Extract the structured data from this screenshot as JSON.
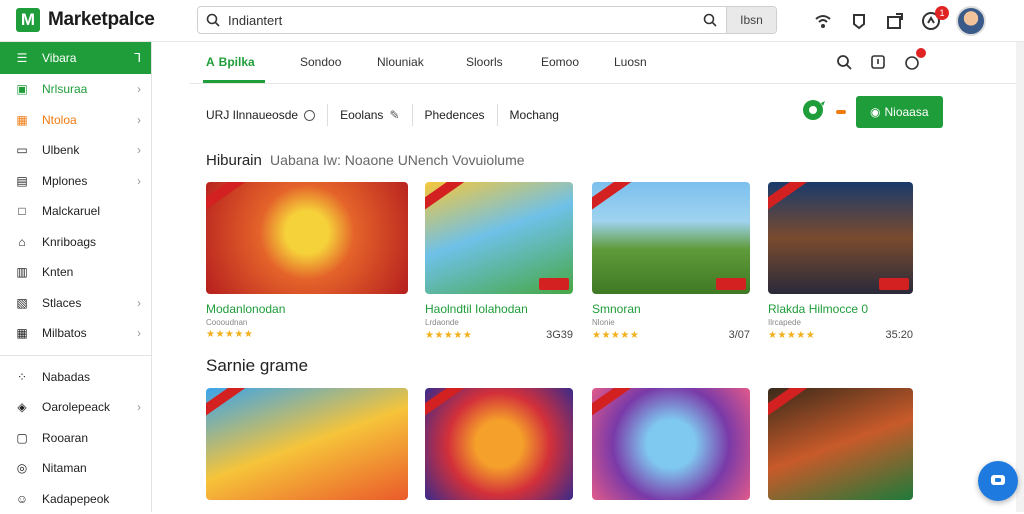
{
  "app": {
    "title": "Marketpalce"
  },
  "search": {
    "value": "Indiantert",
    "filter_label": "Ibsn"
  },
  "header": {
    "notification_count": "1"
  },
  "sidebar": {
    "items": [
      {
        "label": "Vibara",
        "icon": "list-icon",
        "chevron": "⅂",
        "state": "active"
      },
      {
        "label": "Nrlsuraa",
        "icon": "image-icon",
        "chevron": "›",
        "state": "green"
      },
      {
        "label": "Ntoloa",
        "icon": "grid-icon",
        "chevron": "›",
        "state": "orange"
      },
      {
        "label": "Ulbenk",
        "icon": "card-icon",
        "chevron": "›",
        "state": ""
      },
      {
        "label": "Mplones",
        "icon": "apps-icon",
        "chevron": "›",
        "state": ""
      },
      {
        "label": "Malckaruel",
        "icon": "square-icon",
        "chevron": "",
        "state": ""
      },
      {
        "label": "Knriboags",
        "icon": "home-icon",
        "chevron": "",
        "state": ""
      },
      {
        "label": "Knten",
        "icon": "calendar-icon",
        "chevron": "",
        "state": ""
      },
      {
        "label": "Stlaces",
        "icon": "bookmark-icon",
        "chevron": "›",
        "state": ""
      },
      {
        "label": "Milbatos",
        "icon": "table-icon",
        "chevron": "›",
        "state": ""
      }
    ],
    "items2": [
      {
        "label": "Nabadas",
        "icon": "grid-dots-icon",
        "chevron": ""
      },
      {
        "label": "Oarolepeack",
        "icon": "tag-icon",
        "chevron": "›"
      },
      {
        "label": "Rooaran",
        "icon": "box-icon",
        "chevron": ""
      },
      {
        "label": "Nitaman",
        "icon": "target-icon",
        "chevron": ""
      },
      {
        "label": "Kadapepeok",
        "icon": "person-icon",
        "chevron": ""
      }
    ]
  },
  "tabs": [
    "Bpilka",
    "Sondoo",
    "Nlouniak",
    "Sloorls",
    "Eomoo",
    "Luosn"
  ],
  "filters": [
    "URJ Ilnnaueosde",
    "Eoolans",
    "Phedences",
    "Mochang"
  ],
  "cta": {
    "label": "Nioaasa"
  },
  "sections": [
    {
      "title": "Hiburain",
      "subtitle": "Uabana  Iw: Noaone UNench Vovuiolume",
      "cards": [
        {
          "title": "Modanlonodan",
          "sub": "Coooudnan",
          "rating": "★★★★★",
          "price": ""
        },
        {
          "title": "Haolndtil Iolahodan",
          "sub": "Lrdaonde",
          "rating": "★★★★★",
          "price": "3G39"
        },
        {
          "title": "Smnoran",
          "sub": "Nlonie",
          "rating": "★★★★★",
          "price": "3/07"
        },
        {
          "title": "Rlakda Hilmocce 0",
          "sub": "Ilrcapede",
          "rating": "★★★★★",
          "price": "35:20"
        }
      ]
    },
    {
      "title": "Sarnie grame",
      "subtitle": "",
      "cards": [
        {
          "title": "",
          "sub": "",
          "rating": "",
          "price": ""
        },
        {
          "title": "",
          "sub": "",
          "rating": "",
          "price": ""
        },
        {
          "title": "",
          "sub": "",
          "rating": "",
          "price": ""
        },
        {
          "title": "",
          "sub": "",
          "rating": "",
          "price": ""
        }
      ]
    }
  ],
  "colors": {
    "brand": "#1f9d3a",
    "accent_orange": "#f07a12",
    "badge_red": "#e02424",
    "fab_blue": "#1f7ae0"
  }
}
